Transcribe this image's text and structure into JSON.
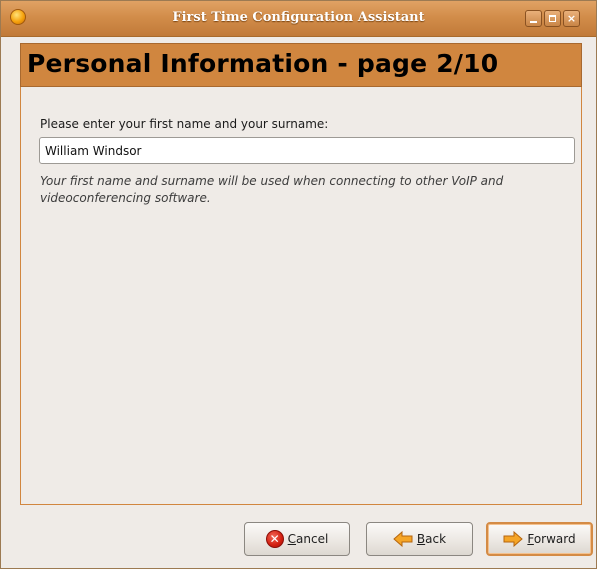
{
  "window": {
    "title": "First Time Configuration Assistant",
    "controls": {
      "minimize_icon": "minimize-icon",
      "maximize_icon": "maximize-icon",
      "close_glyph": "×"
    }
  },
  "header": {
    "title": "Personal Information - page 2/10"
  },
  "form": {
    "prompt": "Please enter your first name and your surname:",
    "name_value": "William Windsor",
    "hint": "Your first name and surname will be used when connecting to other VoIP and videoconferencing software."
  },
  "buttons": {
    "cancel": {
      "prefix": "",
      "mnemonic": "C",
      "rest": "ancel",
      "icon": "cancel-icon"
    },
    "back": {
      "mnemonic": "B",
      "rest": "ack",
      "icon": "back-arrow-icon"
    },
    "forward": {
      "mnemonic": "F",
      "rest": "orward",
      "icon": "forward-arrow-icon"
    }
  },
  "colors": {
    "accent": "#d0863f",
    "titlebar": "#d28d4a",
    "window_bg": "#efebe7",
    "arrow": "#f5a526"
  }
}
